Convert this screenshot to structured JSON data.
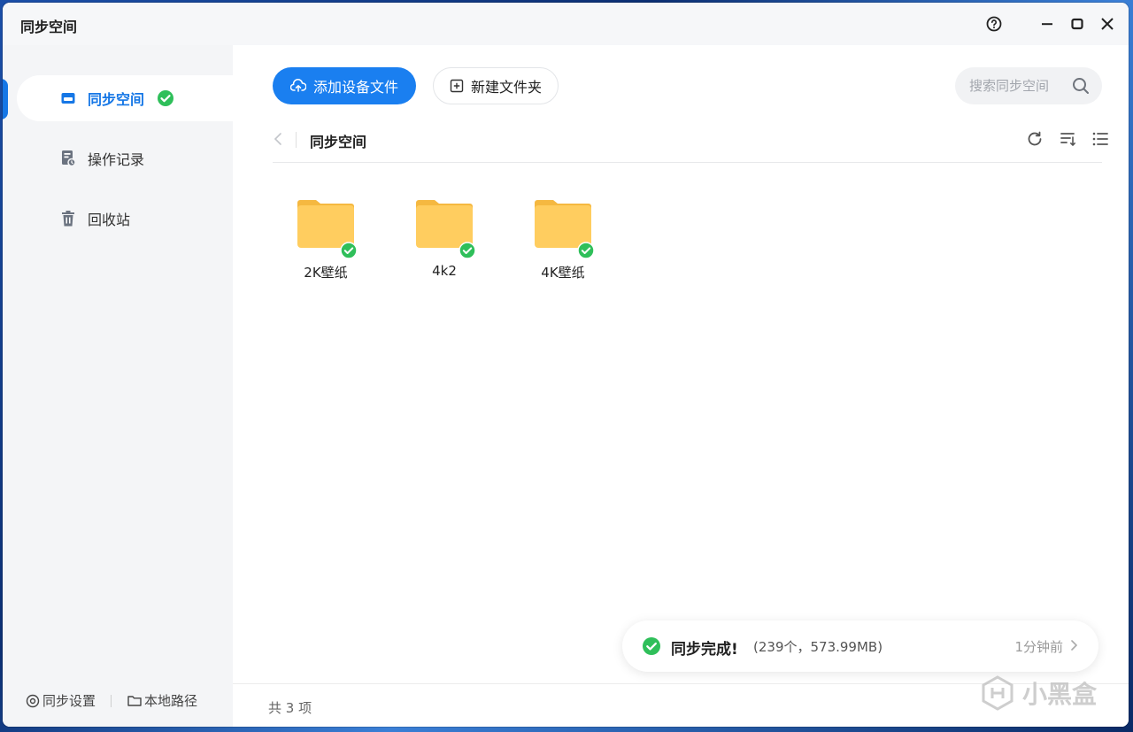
{
  "window": {
    "title": "同步空间"
  },
  "sidebar": {
    "items": [
      {
        "label": "同步空间",
        "icon": "sync-space-icon",
        "active": true
      },
      {
        "label": "操作记录",
        "icon": "record-icon"
      },
      {
        "label": "回收站",
        "icon": "trash-icon"
      }
    ],
    "footer": {
      "settings_label": "同步设置",
      "local_path_label": "本地路径"
    }
  },
  "toolbar": {
    "add_device_label": "添加设备文件",
    "new_folder_label": "新建文件夹",
    "search_placeholder": "搜索同步空间"
  },
  "path": {
    "title": "同步空间"
  },
  "folders": [
    {
      "name": "2K壁纸",
      "synced": true
    },
    {
      "name": "4k2",
      "synced": true
    },
    {
      "name": "4K壁纸",
      "synced": true
    }
  ],
  "status": {
    "count_text": "共 3 项"
  },
  "toast": {
    "title": "同步完成!",
    "detail": "(239个，573.99MB)",
    "time": "1分钟前"
  },
  "watermark": {
    "text": "小黑盒"
  },
  "colors": {
    "accent": "#1a7ff0",
    "success": "#2fbf5a",
    "folder": "#ffcc5a"
  }
}
